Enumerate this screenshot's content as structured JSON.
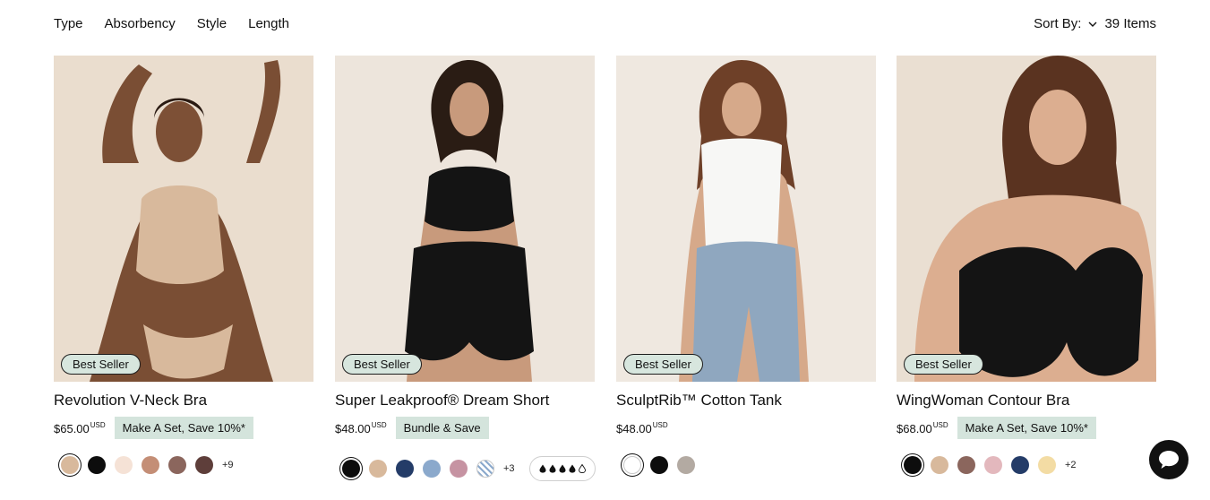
{
  "filters": [
    "Type",
    "Absorbency",
    "Style",
    "Length"
  ],
  "sort": {
    "label": "Sort By:",
    "count": "39 Items"
  },
  "products": [
    {
      "badge": "Best Seller",
      "title": "Revolution V-Neck Bra",
      "price": "$65.00",
      "currency": "USD",
      "promo": "Make A Set, Save 10%*",
      "swatches": [
        "#d8b99c",
        "#0d0d0d",
        "#f5e2d6",
        "#c48e76",
        "#8b665d",
        "#5e3e3a"
      ],
      "more": "+9"
    },
    {
      "badge": "Best Seller",
      "title": "Super Leakproof® Dream Short",
      "price": "$48.00",
      "currency": "USD",
      "promo": "Bundle & Save",
      "swatches": [
        "#0d0d0d",
        "#d8b99c",
        "#243c68",
        "#8ba9cc",
        "#c693a2",
        "pattern"
      ],
      "more": "+3",
      "absorbency_level": 4,
      "absorbency_max": 5
    },
    {
      "badge": "Best Seller",
      "title": "SculptRib™ Cotton Tank",
      "price": "$48.00",
      "currency": "USD",
      "promo": "",
      "swatches": [
        "#ffffff",
        "#0d0d0d",
        "#b3aaa2"
      ],
      "more": ""
    },
    {
      "badge": "Best Seller",
      "title": "WingWoman Contour Bra",
      "price": "$68.00",
      "currency": "USD",
      "promo": "Make A Set, Save 10%*",
      "swatches": [
        "#0d0d0d",
        "#d8b99c",
        "#8b665d",
        "#e3b8bd",
        "#243c68",
        "#f3dca4"
      ],
      "more": "+2"
    }
  ],
  "icons": {
    "sort": "chevron-down-icon",
    "chat": "chat-bubble-icon",
    "absorbency": "droplet-icon"
  },
  "colors": {
    "badge_bg": "#d7e6de",
    "promo_bg": "#d4e4dc",
    "chat_bg": "#111111"
  }
}
